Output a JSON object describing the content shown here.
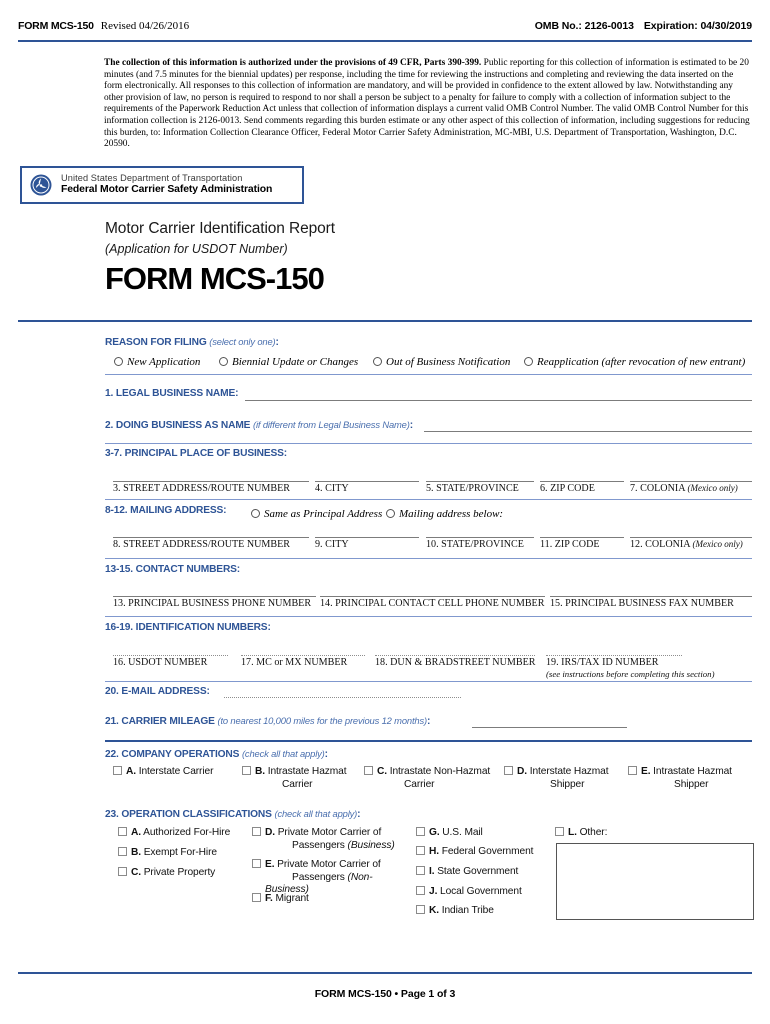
{
  "header": {
    "form_name": "FORM MCS-150",
    "revised": "Revised 04/26/2016",
    "omb": "OMB No.: 2126-0013",
    "expiration": "Expiration: 04/30/2019"
  },
  "privacy": {
    "lead": "The collection of this information is authorized under the provisions of 49 CFR, Parts 390-399.",
    "body": "Public reporting for this collection of information is estimated to be 20 minutes (and 7.5 minutes for the biennial updates) per response, including the time for reviewing the instructions and completing and reviewing the data inserted on the form electronically. All responses to this collection of information are mandatory, and will be provided in confidence to the extent allowed by law. Notwithstanding any other provision of law, no person is required to respond to nor shall a person be subject to a penalty for failure to comply with a collection of information subject to the requirements of the Paperwork Reduction Act unless that collection of information displays a current valid OMB Control Number. The valid OMB Control Number for this information collection is 2126-0013. Send comments regarding this burden estimate or any other aspect of this collection of information, including suggestions for reducing this burden, to: Information Collection Clearance Officer, Federal Motor Carrier Safety Administration, MC-MBI, U.S. Department of Transportation, Washington, D.C. 20590."
  },
  "agency": {
    "line1": "United States Department of Transportation",
    "line2": "Federal Motor Carrier Safety Administration",
    "seal_color": "#2e5496"
  },
  "title": {
    "line1": "Motor Carrier Identification Report",
    "line2": "(Application for USDOT Number)",
    "line3": "FORM MCS-150"
  },
  "reason": {
    "heading": "REASON FOR FILING",
    "hint": "(select only one)",
    "options": [
      "New Application",
      "Biennial Update or Changes",
      "Out of Business Notification",
      "Reapplication (after revocation of new entrant)"
    ]
  },
  "field1": {
    "label": "1. LEGAL BUSINESS NAME:",
    "value": ""
  },
  "field2": {
    "label": "2. DOING BUSINESS AS NAME",
    "hint": "(if different from Legal Business Name)",
    "colon": ":",
    "value": ""
  },
  "principal": {
    "heading": "3-7. PRINCIPAL PLACE OF BUSINESS:",
    "fields": [
      {
        "caption": "3. STREET ADDRESS/ROUTE NUMBER",
        "note": "",
        "value": ""
      },
      {
        "caption": "4. CITY",
        "note": "",
        "value": ""
      },
      {
        "caption": "5. STATE/PROVINCE",
        "note": "",
        "value": ""
      },
      {
        "caption": "6. ZIP CODE",
        "note": "",
        "value": ""
      },
      {
        "caption": "7. COLONIA",
        "note": "(Mexico only)",
        "value": ""
      }
    ]
  },
  "mailing": {
    "heading": "8-12. MAILING ADDRESS:",
    "options": [
      "Same as Principal Address",
      "Mailing address below:"
    ],
    "fields": [
      {
        "caption": "8. STREET ADDRESS/ROUTE NUMBER",
        "note": "",
        "value": ""
      },
      {
        "caption": "9. CITY",
        "note": "",
        "value": ""
      },
      {
        "caption": "10. STATE/PROVINCE",
        "note": "",
        "value": ""
      },
      {
        "caption": "11. ZIP CODE",
        "note": "",
        "value": ""
      },
      {
        "caption": "12. COLONIA",
        "note": "(Mexico only)",
        "value": ""
      }
    ]
  },
  "contact": {
    "heading": "13-15. CONTACT NUMBERS:",
    "fields": [
      {
        "caption": "13. PRINCIPAL BUSINESS PHONE NUMBER",
        "value": ""
      },
      {
        "caption": "14. PRINCIPAL CONTACT CELL PHONE NUMBER",
        "value": ""
      },
      {
        "caption": "15. PRINCIPAL BUSINESS FAX NUMBER",
        "value": ""
      }
    ]
  },
  "identification": {
    "heading": "16-19. IDENTIFICATION NUMBERS:",
    "fields": [
      {
        "caption": "16. USDOT NUMBER",
        "sub": "",
        "value": ""
      },
      {
        "caption": "17. MC or MX NUMBER",
        "sub": "",
        "value": ""
      },
      {
        "caption": "18. DUN & BRADSTREET NUMBER",
        "sub": "",
        "value": ""
      },
      {
        "caption": "19. IRS/TAX ID NUMBER",
        "sub": "(see instructions before completing this section)",
        "value": ""
      }
    ]
  },
  "field20": {
    "label": "20. E-MAIL ADDRESS:",
    "value": ""
  },
  "field21": {
    "label": "21. CARRIER MILEAGE",
    "hint": "(to nearest 10,000 miles for the previous 12 months)",
    "colon": ":",
    "value": ""
  },
  "company_operations": {
    "heading": "22. COMPANY OPERATIONS",
    "hint": "(check all that apply)",
    "items": [
      {
        "letter": "A.",
        "label": "Interstate Carrier",
        "label2": ""
      },
      {
        "letter": "B.",
        "label": "Intrastate Hazmat",
        "label2": "Carrier"
      },
      {
        "letter": "C.",
        "label": "Intrastate Non-Hazmat",
        "label2": "Carrier"
      },
      {
        "letter": "D.",
        "label": "Interstate Hazmat",
        "label2": "Shipper"
      },
      {
        "letter": "E.",
        "label": "Intrastate Hazmat",
        "label2": "Shipper"
      }
    ]
  },
  "operation_classifications": {
    "heading": "23. OPERATION CLASSIFICATIONS",
    "hint": "(check all that apply)",
    "col1": [
      {
        "letter": "A.",
        "label": "Authorized For-Hire"
      },
      {
        "letter": "B.",
        "label": "Exempt For-Hire"
      },
      {
        "letter": "C.",
        "label": "Private Property"
      }
    ],
    "col2": [
      {
        "letter": "D.",
        "label": "Private Motor Carrier of",
        "label2": "Passengers ",
        "label2_ital": "(Business)"
      },
      {
        "letter": "E.",
        "label": "Private Motor Carrier of",
        "label2": "Passengers ",
        "label2_ital": "(Non-Business)"
      },
      {
        "letter": "F.",
        "label": "Migrant",
        "label2": "",
        "label2_ital": ""
      }
    ],
    "col3": [
      {
        "letter": "G.",
        "label": "U.S. Mail"
      },
      {
        "letter": "H.",
        "label": "Federal Government"
      },
      {
        "letter": "I.",
        "label": "State Government"
      },
      {
        "letter": "J.",
        "label": "Local Government"
      },
      {
        "letter": "K.",
        "label": "Indian Tribe"
      }
    ],
    "col4": [
      {
        "letter": "L.",
        "label": "Other:"
      }
    ],
    "other_value": ""
  },
  "footer": {
    "text": "FORM MCS-150 • Page 1 of 3"
  },
  "colors": {
    "accent_blue": "#2e5496",
    "light_blue_rule": "#8098ce",
    "field_line": "#7c7c7c"
  }
}
